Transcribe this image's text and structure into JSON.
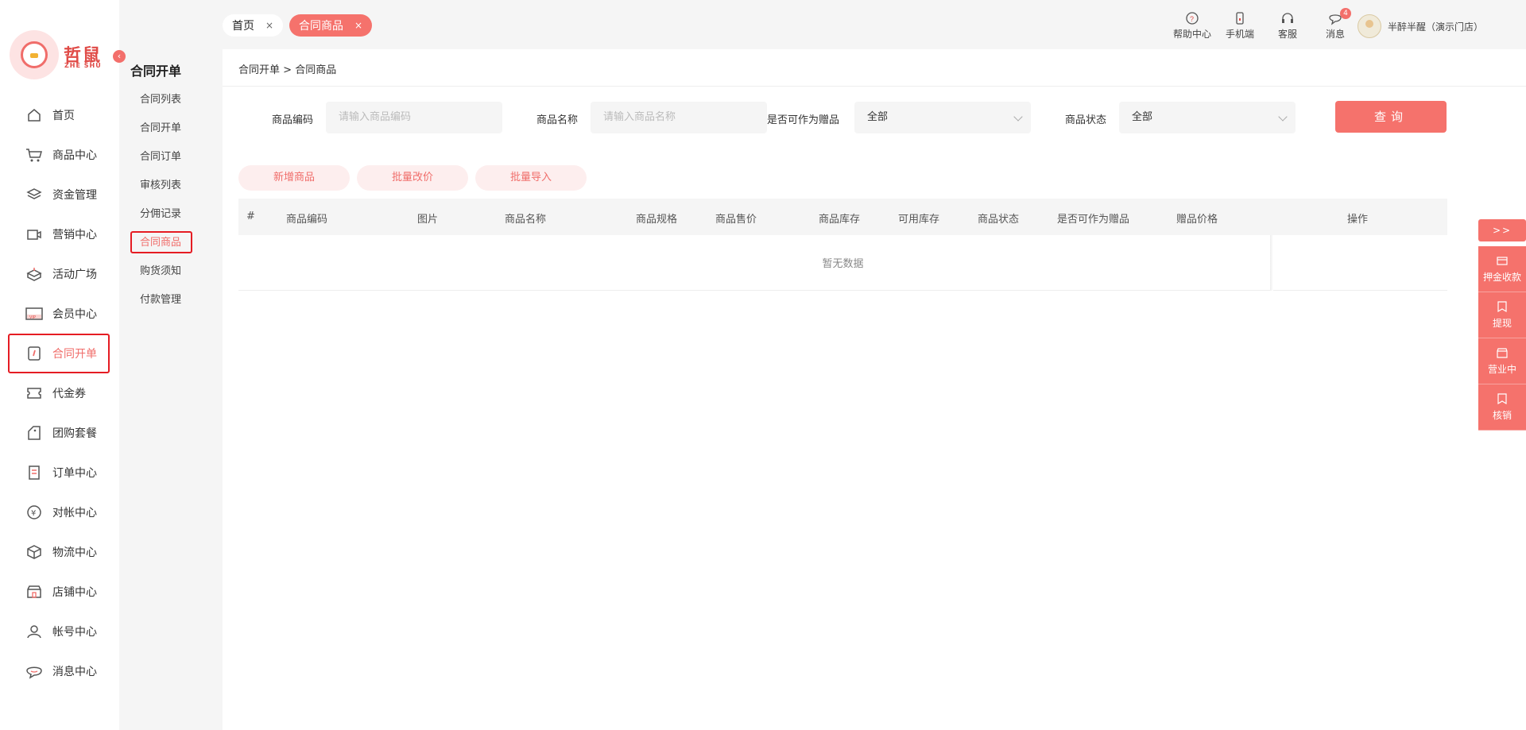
{
  "brand": {
    "name": "哲鼠",
    "sub": "ZHE SHU"
  },
  "sidebar": {
    "items": [
      {
        "label": "首页",
        "icon": "home-icon"
      },
      {
        "label": "商品中心",
        "icon": "cart-icon"
      },
      {
        "label": "资金管理",
        "icon": "layers-icon"
      },
      {
        "label": "营销中心",
        "icon": "marketing-icon"
      },
      {
        "label": "活动广场",
        "icon": "gift-box-icon"
      },
      {
        "label": "会员中心",
        "icon": "vip-card-icon"
      },
      {
        "label": "合同开单",
        "icon": "contract-icon",
        "active": true
      },
      {
        "label": "代金券",
        "icon": "coupon-icon"
      },
      {
        "label": "团购套餐",
        "icon": "tag-icon"
      },
      {
        "label": "订单中心",
        "icon": "order-icon"
      },
      {
        "label": "对帐中心",
        "icon": "yen-icon"
      },
      {
        "label": "物流中心",
        "icon": "package-icon"
      },
      {
        "label": "店铺中心",
        "icon": "store-icon"
      },
      {
        "label": "帐号中心",
        "icon": "user-icon"
      },
      {
        "label": "消息中心",
        "icon": "message-icon"
      }
    ]
  },
  "submenu": {
    "title": "合同开单",
    "items": [
      {
        "label": "合同列表"
      },
      {
        "label": "合同开单"
      },
      {
        "label": "合同订单"
      },
      {
        "label": "审核列表"
      },
      {
        "label": "分佣记录"
      },
      {
        "label": "合同商品",
        "active": true
      },
      {
        "label": "购货须知"
      },
      {
        "label": "付款管理"
      }
    ]
  },
  "tabs": [
    {
      "label": "首页",
      "close": "×"
    },
    {
      "label": "合同商品",
      "close": "×"
    }
  ],
  "topbar": {
    "help": "帮助中心",
    "mobile": "手机端",
    "service": "客服",
    "messages": "消息",
    "message_count": "4",
    "user_name": "半醉半醒（演示门店）"
  },
  "breadcrumb": {
    "parent": "合同开单",
    "separator": ">",
    "current": "合同商品"
  },
  "filters": {
    "code_label": "商品编码",
    "code_placeholder": "请输入商品编码",
    "name_label": "商品名称",
    "name_placeholder": "请输入商品名称",
    "gift_label": "是否可作为赠品",
    "gift_value": "全部",
    "status_label": "商品状态",
    "status_value": "全部",
    "query": "查询"
  },
  "actions": {
    "add": "新增商品",
    "batch_price": "批量改价",
    "batch_import": "批量导入"
  },
  "table": {
    "columns": [
      "#",
      "商品编码",
      "图片",
      "商品名称",
      "商品规格",
      "商品售价",
      "商品库存",
      "可用库存",
      "商品状态",
      "是否可作为赠品",
      "赠品价格",
      "操作"
    ],
    "empty": "暂无数据"
  },
  "right_panel": {
    "toggle": ">>",
    "items": [
      {
        "label": "押金收款",
        "icon": "card-icon"
      },
      {
        "label": "提现",
        "icon": "withdraw-icon"
      },
      {
        "label": "营业中",
        "icon": "shop-open-icon"
      },
      {
        "label": "核销",
        "icon": "verify-icon"
      }
    ]
  },
  "colors": {
    "accent": "#f5726c",
    "accent_light": "#fdeeee",
    "highlight_border": "#e51c23"
  }
}
